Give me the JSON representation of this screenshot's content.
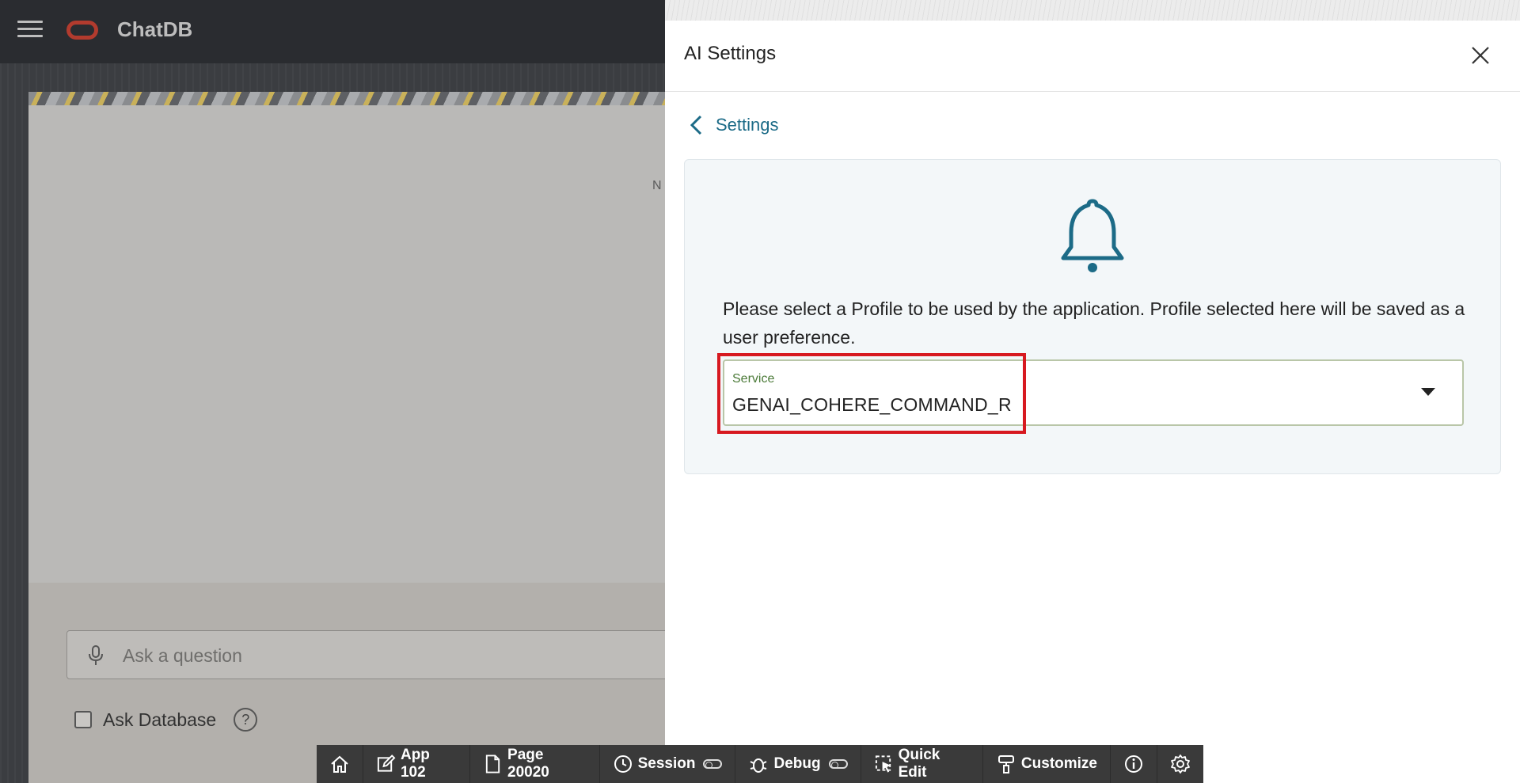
{
  "app": {
    "title": "ChatDB"
  },
  "background": {
    "cut_text": "N",
    "ask_placeholder": "Ask a question",
    "ask_database_label": "Ask Database",
    "help_symbol": "?"
  },
  "drawer": {
    "title": "AI Settings",
    "back_label": "Settings",
    "message": "Please select a Profile to be used by the application. Profile selected here will be saved as a user preference.",
    "service_field": {
      "label": "Service",
      "value": "GENAI_COHERE_COMMAND_R"
    }
  },
  "dev_toolbar": {
    "items": [
      {
        "icon": "home-icon",
        "label": ""
      },
      {
        "icon": "edit-icon",
        "label": "App 102"
      },
      {
        "icon": "page-icon",
        "label": "Page 20020"
      },
      {
        "icon": "session-icon",
        "label": "Session"
      },
      {
        "icon": "debug-icon",
        "label": "Debug"
      },
      {
        "icon": "quick-edit-icon",
        "label": "Quick Edit"
      },
      {
        "icon": "customize-icon",
        "label": "Customize"
      },
      {
        "icon": "info-icon",
        "label": ""
      },
      {
        "icon": "gear-icon",
        "label": ""
      }
    ]
  },
  "colors": {
    "accent": "#1c6b87",
    "highlight": "#d71920",
    "logo": "#b23b2e"
  }
}
